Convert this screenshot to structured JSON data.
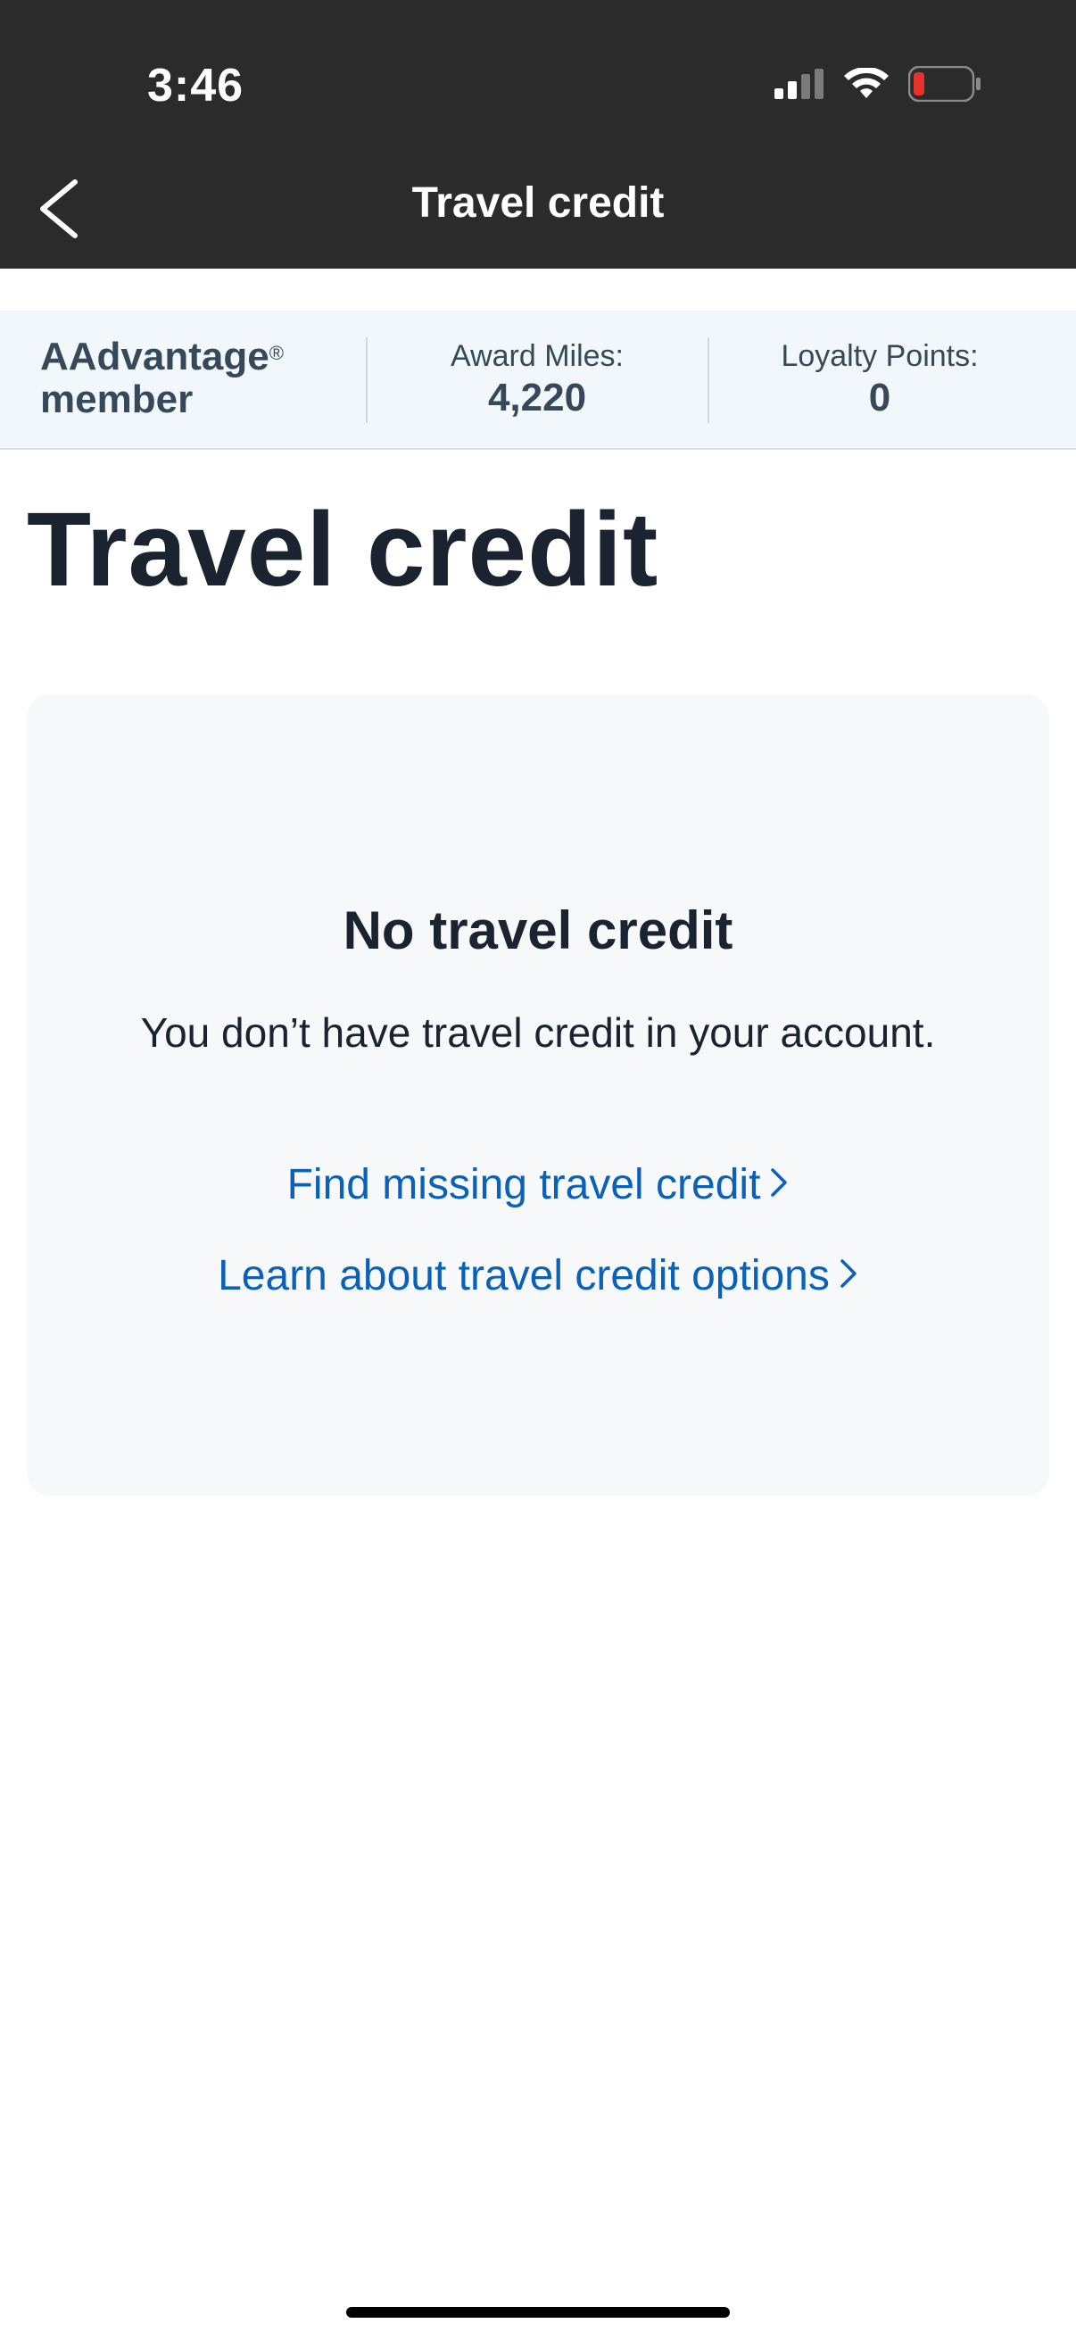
{
  "status_bar": {
    "time": "3:46"
  },
  "nav": {
    "title": "Travel credit",
    "back_icon": "chevron-left-icon"
  },
  "membership": {
    "program": "AAdvantage",
    "registered_mark": "®",
    "level": "member",
    "award_miles_label": "Award Miles:",
    "award_miles_value": "4,220",
    "loyalty_points_label": "Loyalty Points:",
    "loyalty_points_value": "0"
  },
  "page": {
    "title": "Travel credit"
  },
  "empty_state": {
    "title": "No travel credit",
    "message": "You don’t have travel credit in your account.",
    "link_find": "Find missing travel credit",
    "link_learn": "Learn about travel credit options",
    "link_icon": "chevron-right-icon"
  },
  "colors": {
    "header_bg": "#2b2b2b",
    "link": "#0b61b8",
    "battery_low": "#e5322d"
  }
}
